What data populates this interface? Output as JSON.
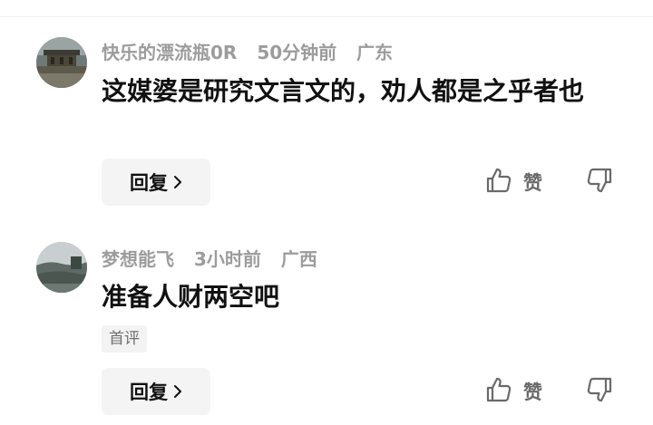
{
  "comments": [
    {
      "username": "快乐的漂流瓶0R",
      "time": "50分钟前",
      "location": "广东",
      "text": "这媒婆是研究文言文的，劝人都是之乎者也",
      "badge": "",
      "reply_label": "回复",
      "like_label": "赞"
    },
    {
      "username": "梦想能飞",
      "time": "3小时前",
      "location": "广西",
      "text": "准备人财两空吧",
      "badge": "首评",
      "reply_label": "回复",
      "like_label": "赞"
    }
  ],
  "icons": {
    "reply_chevron": "chevron-right-icon",
    "like": "thumbs-up-icon",
    "dislike": "thumbs-down-icon"
  },
  "colors": {
    "meta_text": "#9c9c9c",
    "content_text": "#111111",
    "button_bg": "#f4f4f4",
    "icon_stroke": "#6a6a6a"
  }
}
